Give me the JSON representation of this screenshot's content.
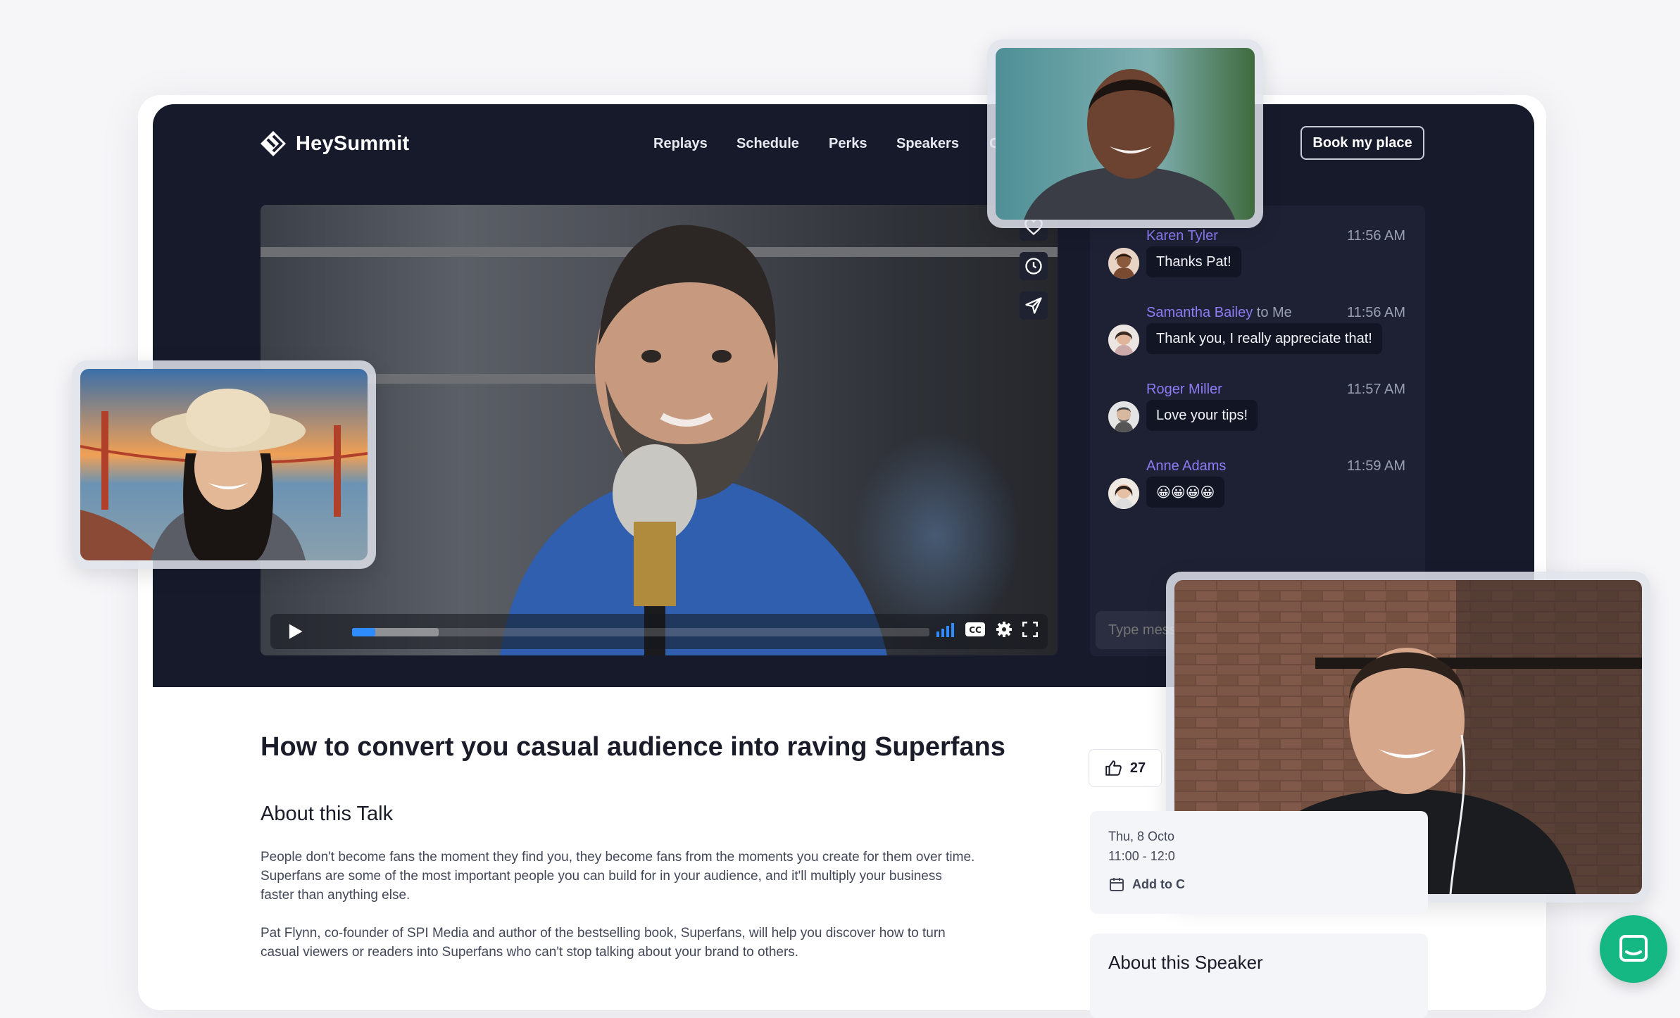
{
  "header": {
    "brand": "HeySummit",
    "nav": [
      "Replays",
      "Schedule",
      "Perks",
      "Speakers",
      "C"
    ],
    "cta": "Book my place"
  },
  "player": {
    "progress_percent": 4,
    "buffered_percent": 15
  },
  "chat": {
    "messages": [
      {
        "name": "Karen Tyler",
        "recipient": "",
        "time": "11:56 AM",
        "text": "Thanks Pat!"
      },
      {
        "name": "Samantha Bailey",
        "recipient": "to Me",
        "time": "11:56 AM",
        "text": "Thank you, I really appreciate that!"
      },
      {
        "name": "Roger Miller",
        "recipient": "",
        "time": "11:57 AM",
        "text": "Love your tips!"
      },
      {
        "name": "Anne Adams",
        "recipient": "",
        "time": "11:59 AM",
        "text": "😀😀😀😀"
      }
    ],
    "input_placeholder": "Type mess"
  },
  "talk": {
    "title": "How to convert you casual audience into raving Superfans",
    "about_heading": "About this Talk",
    "paragraph1": "People don't become fans the moment they find you, they become fans from the moments you create for them over time. Superfans are some of the most important people you can build for in your audience, and it'll multiply your business faster than anything else.",
    "paragraph2": "Pat Flynn, co-founder of SPI Media and author of the bestselling book, Superfans, will help you discover how to turn casual viewers or readers into Superfans who can't stop talking about your brand to others.",
    "likes": "27"
  },
  "event": {
    "date": "Thu, 8 Octo",
    "time": "11:00 - 12:0",
    "add_to_calendar": "Add to C"
  },
  "speaker": {
    "heading": "About this Speaker"
  },
  "colors": {
    "dark_bg": "#161a2b",
    "chat_name": "#8d7cf6",
    "progress": "#2e8cff",
    "help_button": "#15b883"
  }
}
